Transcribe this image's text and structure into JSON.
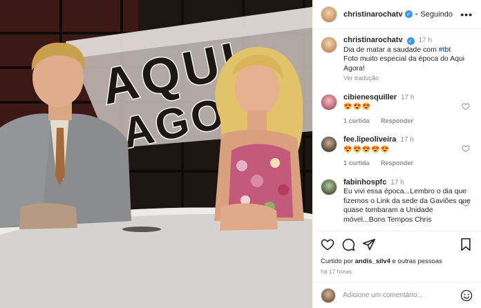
{
  "post": {
    "username": "christinarochatv",
    "follow_status": "Seguindo",
    "separator": "•",
    "more_label": "•••",
    "verified_mark": "✓",
    "image_sign_lines": [
      "AQUI",
      "AGORA"
    ]
  },
  "caption": {
    "username": "christinarochatv",
    "time": "17 h",
    "text_before_tag": "Dia de matar a saudade com ",
    "hashtag": "#tbt",
    "text_after_tag": "Foto muito especial da época do Aqui Agora!",
    "translate_label": "Ver tradução"
  },
  "comments": [
    {
      "username": "cibienesquiller",
      "time": "17 h",
      "text": "😍😍😍",
      "likes": "1 curtida",
      "reply_label": "Responder"
    },
    {
      "username": "fee.lipeoliveira",
      "time": "17 h",
      "text": "😍😍😍😍😍",
      "likes": "1 curtida",
      "reply_label": "Responder"
    },
    {
      "username": "fabinhospfc",
      "time": "17 h",
      "text": "Eu vivi essa época...Lembro o dia que fizemos o Link da sede da Gaviões que quase tombaram a Unidade móvel...Bons Tempos Chris"
    }
  ],
  "actions": {
    "liked_by_prefix": "Curtido por ",
    "liked_by_user": "andis_silv4",
    "liked_by_suffix": " e outras pessoas",
    "posted_ago": "há 17 horas"
  },
  "add_comment": {
    "placeholder": "Adicione um comentário..."
  },
  "colors": {
    "link": "#00376b",
    "muted": "#8e8e8e",
    "verified": "#3897f0",
    "text": "#262626"
  },
  "icons": [
    "more-options-icon",
    "verified-icon",
    "heart-icon",
    "comment-icon",
    "share-icon",
    "save-icon",
    "emoji-icon"
  ]
}
